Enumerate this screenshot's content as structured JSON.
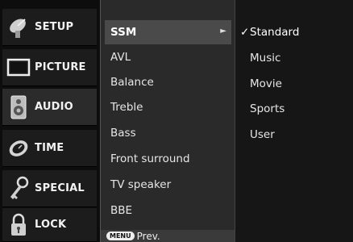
{
  "tabs": [
    {
      "label": "SETUP",
      "icon": "satellite-dish-icon"
    },
    {
      "label": "PICTURE",
      "icon": "tv-screen-icon"
    },
    {
      "label": "AUDIO",
      "icon": "speaker-icon"
    },
    {
      "label": "TIME",
      "icon": "clock-icon"
    },
    {
      "label": "SPECIAL",
      "icon": "key-icon"
    },
    {
      "label": "LOCK",
      "icon": "padlock-icon"
    }
  ],
  "active_tab": "AUDIO",
  "menu": {
    "items": [
      "SSM",
      "AVL",
      "Balance",
      "Treble",
      "Bass",
      "Front surround",
      "TV speaker",
      "BBE"
    ],
    "selected": "SSM",
    "footer_key": "MENU",
    "footer_label": "Prev."
  },
  "options": {
    "items": [
      "Standard",
      "Music",
      "Movie",
      "Sports",
      "User"
    ],
    "checked": "Standard",
    "check_mark": "✓"
  }
}
